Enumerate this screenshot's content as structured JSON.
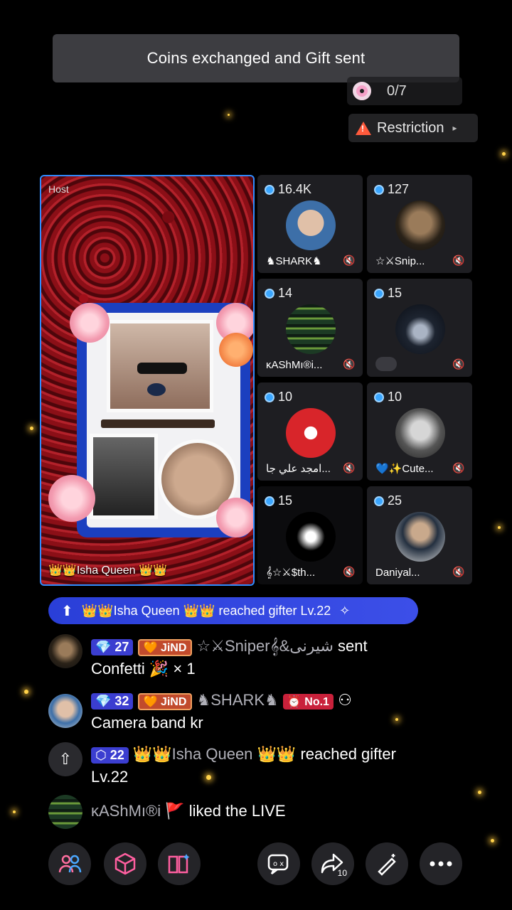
{
  "toast": {
    "text": "Coins exchanged and Gift sent"
  },
  "gift_counter": {
    "value": "0/7"
  },
  "restriction": {
    "label": "Restriction"
  },
  "host": {
    "label": "Host",
    "name": "👑👑Isha Queen 👑👑"
  },
  "guests": [
    {
      "coins": "16.4K",
      "name": "♞SHARK♞"
    },
    {
      "coins": "127",
      "name": "☆⚔Snip..."
    },
    {
      "coins": "14",
      "name": "ĸAShMı®i..."
    },
    {
      "coins": "15",
      "name": ""
    },
    {
      "coins": "10",
      "name": "امجد علي جا..."
    },
    {
      "coins": "10",
      "name": "💙✨Cute..."
    },
    {
      "coins": "15",
      "name": "𝄞☆⚔$th..."
    },
    {
      "coins": "25",
      "name": "Daniyal..."
    }
  ],
  "banner": {
    "text": "👑👑Isha Queen 👑👑 reached gifter Lv.22"
  },
  "chat": [
    {
      "level": "27",
      "fan": "JiND",
      "user": "☆⚔Sniper𝄞&شیرنی",
      "verb": "sent",
      "line2": "Confetti 🎉 × 1"
    },
    {
      "level": "32",
      "fan": "JiND",
      "user": "♞SHARK♞",
      "rank": "No.1",
      "line2": "Camera band kr"
    },
    {
      "level": "22",
      "user": "👑👑Isha Queen 👑👑",
      "verb": "reached gifter",
      "line2": "Lv.22"
    },
    {
      "user": "ĸAShMı®i",
      "verb": "liked the LIVE"
    }
  ],
  "bottom_bar": {
    "share_count": "10"
  }
}
